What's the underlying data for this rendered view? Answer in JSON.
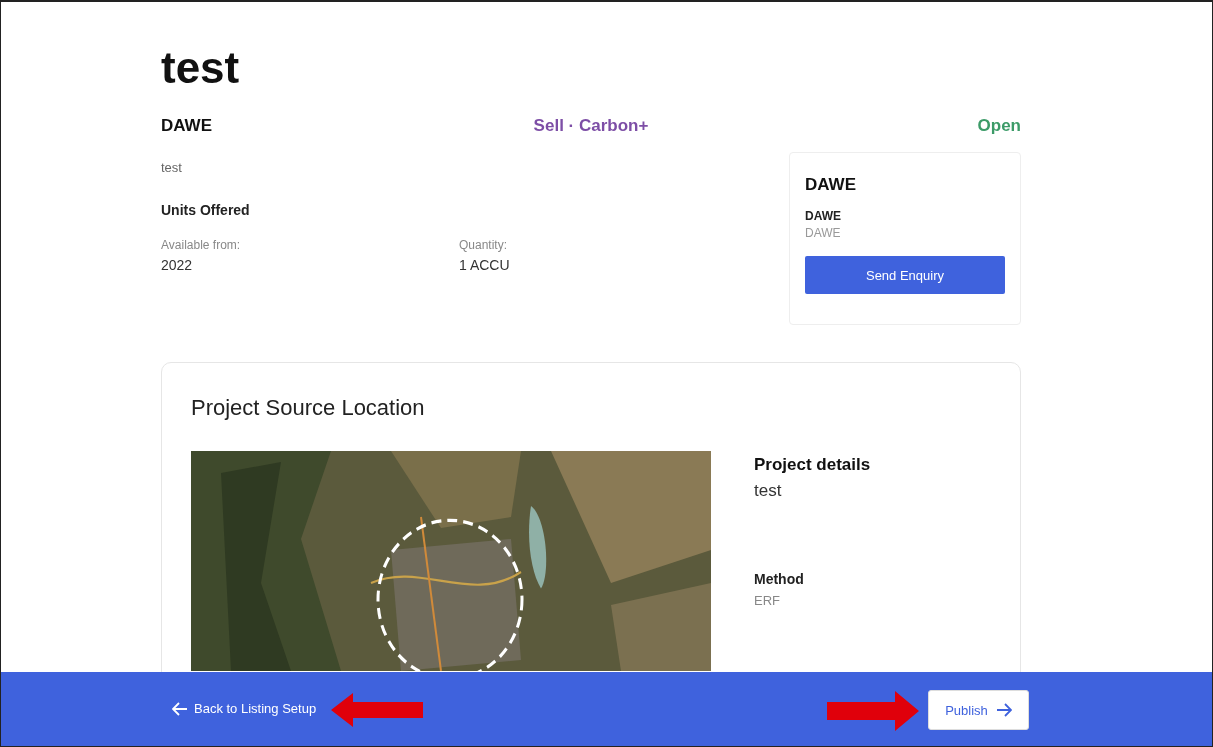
{
  "page": {
    "title": "test"
  },
  "listing": {
    "organisation": "DAWE",
    "type": "Sell · Carbon+",
    "status": "Open",
    "description": "test",
    "units_heading": "Units Offered",
    "fields": [
      {
        "label": "Available from:",
        "value": "2022"
      },
      {
        "label": "Quantity:",
        "value": "1 ACCU"
      }
    ]
  },
  "seller_card": {
    "title": "DAWE",
    "name": "DAWE",
    "subtitle": "DAWE",
    "button": "Send Enquiry"
  },
  "location": {
    "title": "Project Source Location",
    "details": [
      {
        "label": "Project details",
        "value": "test",
        "kind": "large"
      },
      {
        "label": "Method",
        "value": "ERF",
        "kind": "small"
      }
    ]
  },
  "footer": {
    "back": "Back to Listing Setup",
    "publish": "Publish"
  }
}
